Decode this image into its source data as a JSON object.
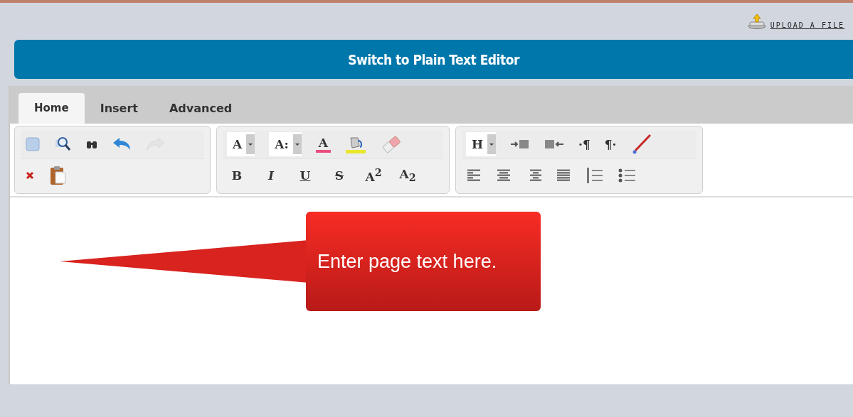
{
  "upload_link": "UPLOAD A FILE",
  "switch_button": "Switch to Plain Text Editor",
  "tabs": [
    {
      "label": "Home",
      "selected": true
    },
    {
      "label": "Insert",
      "selected": false
    },
    {
      "label": "Advanced",
      "selected": false
    }
  ],
  "toolbar": {
    "redo_disabled": true,
    "font_button": "A",
    "size_button": "A:",
    "color_button": "A",
    "format_buttons": [
      "B",
      "I",
      "U",
      "S",
      "A$^{2}$",
      "A$_{2}$"
    ],
    "heading_button": "H",
    "ltr_button": "·¶",
    "rtl_button": "¶·"
  },
  "callout": "Enter page text here."
}
